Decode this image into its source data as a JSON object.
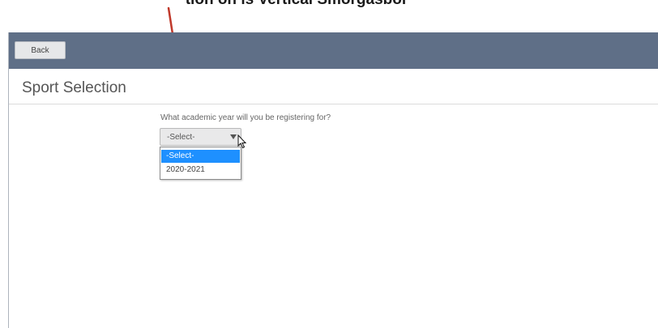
{
  "caption": {
    "text": "tion on is Vertical Smorgasbor"
  },
  "toolbar": {
    "back_label": "Back"
  },
  "page": {
    "title": "Sport Selection"
  },
  "form": {
    "question": "What academic year will you be registering for?",
    "select": {
      "selected": "-Select-",
      "options": [
        "-Select-",
        "2020-2021"
      ]
    }
  },
  "colors": {
    "toolbar": "#5f6f87",
    "highlight": "#1e90ff",
    "arrow": "#c0392b"
  },
  "icons": [
    "arrow-annotation-icon",
    "chevron-down-icon",
    "mouse-cursor-icon"
  ]
}
